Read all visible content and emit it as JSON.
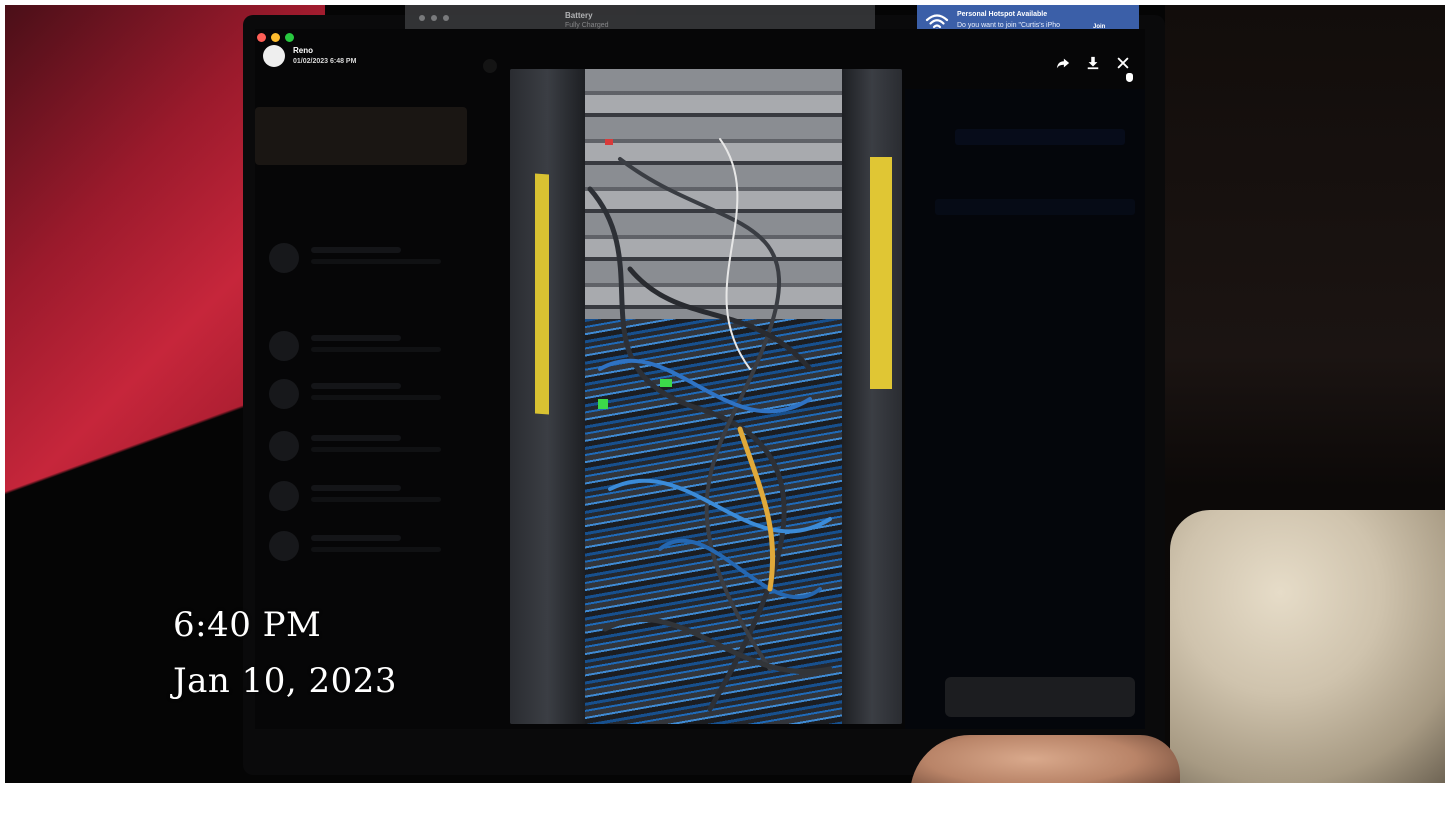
{
  "menubar_window": {
    "title": "Battery",
    "subtitle": "Fully Charged"
  },
  "notification": {
    "title": "Personal Hotspot Available",
    "body": "Do you want to join \"Curtis's iPho",
    "action": "Join",
    "icon": "wifi-icon"
  },
  "viewer": {
    "sender_name": "Reno",
    "sent_datetime": "01/02/2023 6:48 PM",
    "actions": [
      "share-icon",
      "download-icon",
      "close-icon"
    ]
  },
  "photo": {
    "description_icon": "photo"
  },
  "overlay": {
    "time": "6:40 PM",
    "date": "Jan 10, 2023"
  },
  "colors": {
    "notification_bg": "#3b5fa8",
    "close_dot": "#fe5f57",
    "min_dot": "#febc2e",
    "max_dot": "#28c840"
  }
}
